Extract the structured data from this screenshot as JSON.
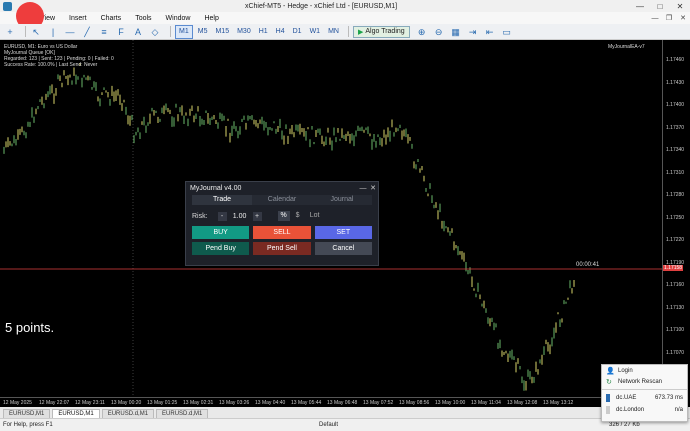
{
  "window": {
    "title": "xChief-MT5 - Hedge - xChief Ltd - [EURUSD,M1]",
    "controls": [
      "—",
      "□",
      "✕"
    ]
  },
  "menu": [
    "View",
    "Insert",
    "Charts",
    "Tools",
    "Window",
    "Help"
  ],
  "toolbar": {
    "timeframes": [
      "M1",
      "M5",
      "M15",
      "M30",
      "H1",
      "H4",
      "D1",
      "W1",
      "MN"
    ],
    "active_timeframe": "M1",
    "algo_label": "Algo Trading"
  },
  "chart": {
    "info_line1": "EURUSD, M1: Euro vs US Dollar",
    "info_line2": "MyJournal Queue [OK]",
    "info_line3": "Regarded: 123 | Sent: 123 | Pending: 0 | Failed: 0",
    "info_line4": "Success Rate: 100.0% | Last Send: Never",
    "ea_label": "MyJournalEA-v7",
    "countdown": "00:00:41",
    "points_label": "5 points.",
    "price_ticks": [
      "1.17460",
      "1.17430",
      "1.17400",
      "1.17370",
      "1.17340",
      "1.17310",
      "1.17280",
      "1.17250",
      "1.17220",
      "1.17190",
      "1.17160",
      "1.17130",
      "1.17100",
      "1.17070",
      "1.17040"
    ],
    "current_price": "1.17158",
    "time_ticks": [
      "12 May 2025",
      "12 May 22:07",
      "12 May 23:11",
      "13 May 00:20",
      "13 May 01:25",
      "13 May 02:31",
      "13 May 03:26",
      "13 May 04:40",
      "13 May 05:44",
      "13 May 06:48",
      "13 May 07:52",
      "13 May 08:56",
      "13 May 10:00",
      "13 May 11:04",
      "13 May 12:08",
      "13 May 13:12"
    ]
  },
  "panel": {
    "title": "MyJournal v4.00",
    "tabs": [
      "Trade",
      "Calendar",
      "Journal"
    ],
    "risk_label": "Risk:",
    "minus": "-",
    "risk_value": "1.00",
    "plus": "+",
    "units": [
      "%",
      "$",
      "Lot"
    ],
    "buttons_row1": [
      "BUY",
      "SELL",
      "SET"
    ],
    "buttons_row2": [
      "Pend Buy",
      "Pend Sell",
      "Cancel"
    ]
  },
  "chart_tabs": [
    "EURUSD,M1",
    "EURUSD,M1",
    "EURUSD.d,M1",
    "EURUSD.d,M1"
  ],
  "status": {
    "help": "For Help, press F1",
    "profile": "Default",
    "traffic": "326 / 27 Kb"
  },
  "popup": {
    "login": "Login",
    "rescan": "Network Rescan",
    "servers": [
      {
        "name": "dc.UAE",
        "ping": "673.73 ms"
      },
      {
        "name": "dc.London",
        "ping": "n/a"
      }
    ]
  }
}
